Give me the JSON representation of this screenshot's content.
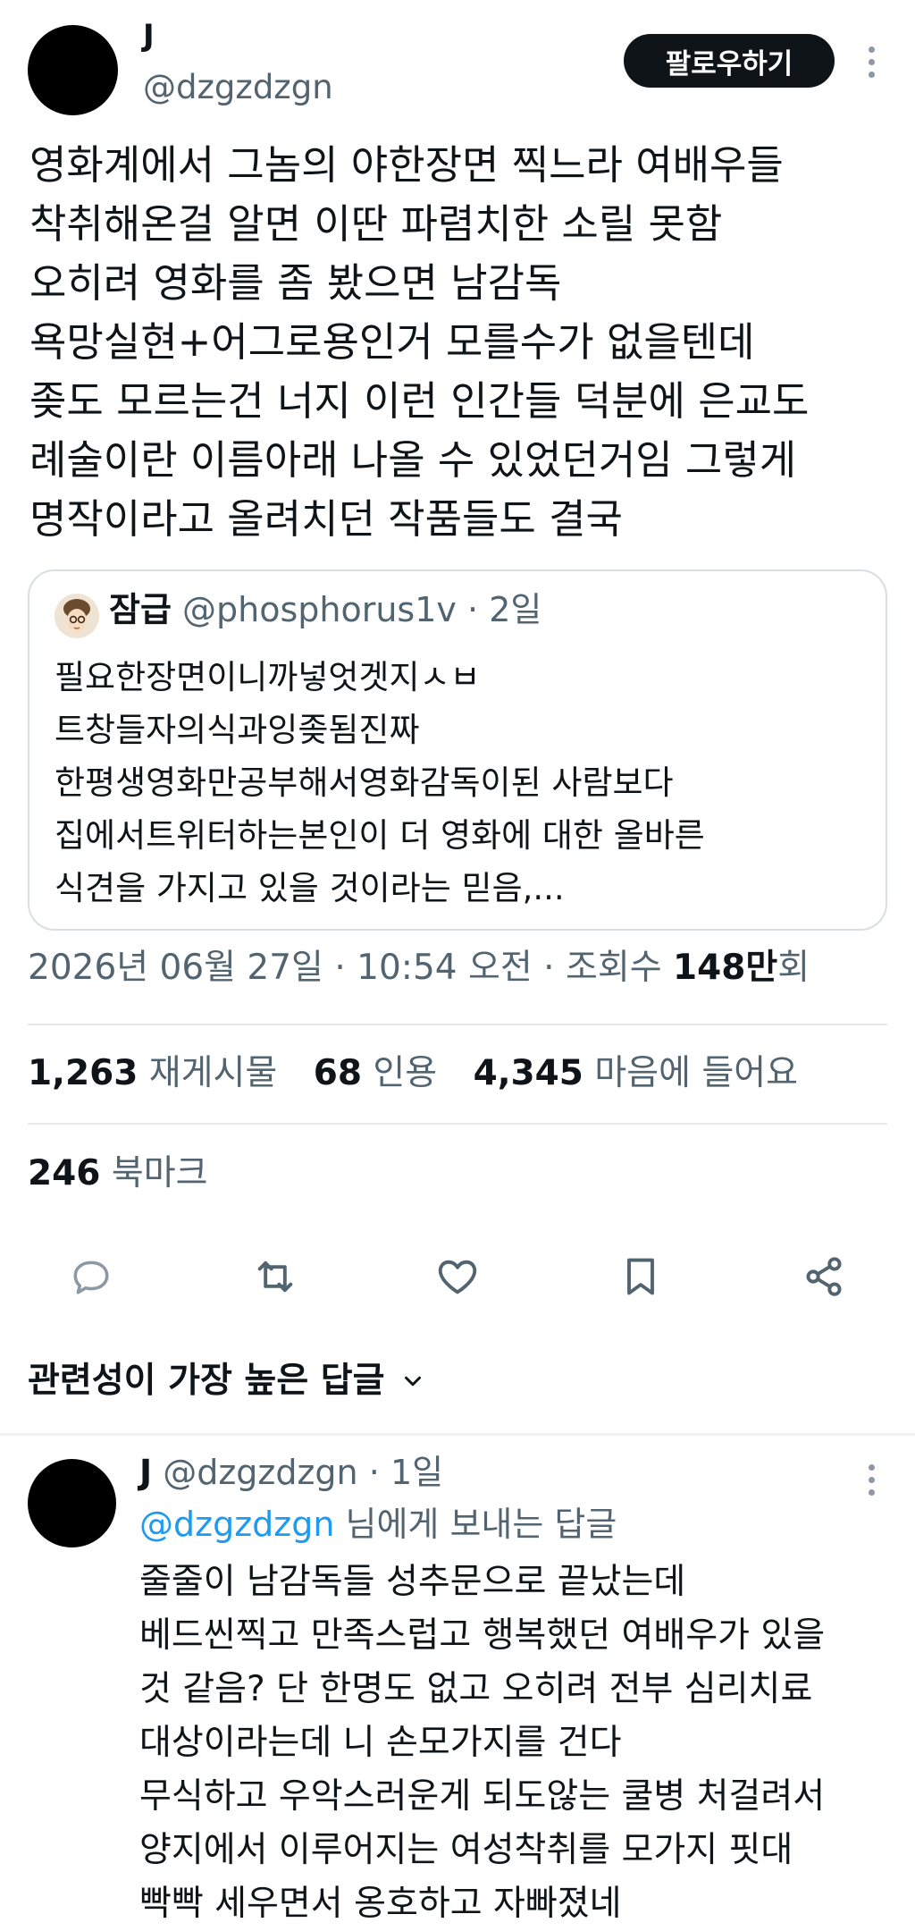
{
  "tweet": {
    "author_name": "J",
    "author_handle": "@dzgzdzgn",
    "follow_label": "팔로우하기",
    "text_lines": [
      "영화계에서 그놈의 야한장면 찍느라 여배우들",
      "착취해온걸 알면 이딴 파렴치한 소릴 못함",
      "오히려 영화를 좀 봤으면 남감독",
      "욕망실현+어그로용인거 모를수가 없을텐데",
      "좆도 모르는건 너지 이런 인간들 덕분에 은교도",
      "례술이란 이름아래 나올 수 있었던거임 그렇게",
      "명작이라고 올려치던 작품들도 결국"
    ],
    "quote": {
      "author_name": "잠급",
      "author_handle": "@phosphorus1v",
      "time": "2일",
      "separator": "·",
      "text_lines": [
        "필요한장면이니까넣엇겟지ㅅㅂ",
        "트창들자의식과잉좆됨진짜",
        "한평생영화만공부해서영화감독이된 사람보다",
        "집에서트위터하는본인이 더 영화에 대한 올바른",
        "식견을 가지고 있을 것이라는 믿음,..."
      ]
    },
    "meta": {
      "date": "2026년 06월 27일",
      "time": "10:54 오전",
      "separator": "·",
      "views_label": "조회수",
      "views_count": "148만",
      "views_suffix": "회"
    },
    "stats": {
      "reposts_count": "1,263",
      "reposts_label": "재게시물",
      "quotes_count": "68",
      "quotes_label": "인용",
      "likes_count": "4,345",
      "likes_label": "마음에 들어요"
    },
    "bookmarks": {
      "count": "246",
      "label": "북마크"
    },
    "actions": [
      "reply-icon",
      "repost-icon",
      "heart-icon",
      "bookmark-icon",
      "share-icon"
    ]
  },
  "replies_header": {
    "label": "관련성이 가장 높은 답글",
    "icon": "chevron-down-icon"
  },
  "reply": {
    "author_name": "J",
    "author_handle": "@dzgzdzgn",
    "time": "1일",
    "separator": "·",
    "reply_to_mention": "@dzgzdzgn",
    "reply_to_suffix": "님에게 보내는 답글",
    "text_lines": [
      "줄줄이 남감독들 성추문으로 끝났는데",
      "베드씬찍고 만족스럽고 행복했던 여배우가 있을",
      "것 같음? 단 한명도 없고 오히려 전부 심리치료",
      "대상이라는데 니 손모가지를 건다",
      "무식하고 우악스러운게 되도않는 쿨병 처걸려서",
      "양지에서 이루어지는 여성착취를 모가지 핏대",
      "빡빡 세우면서 옹호하고 자빠졌네"
    ]
  },
  "colors": {
    "text": "#0f1419",
    "secondary": "#536471",
    "link": "#1d9bf0",
    "divider": "#e6e9ec",
    "follow_bg": "#0f1419"
  }
}
